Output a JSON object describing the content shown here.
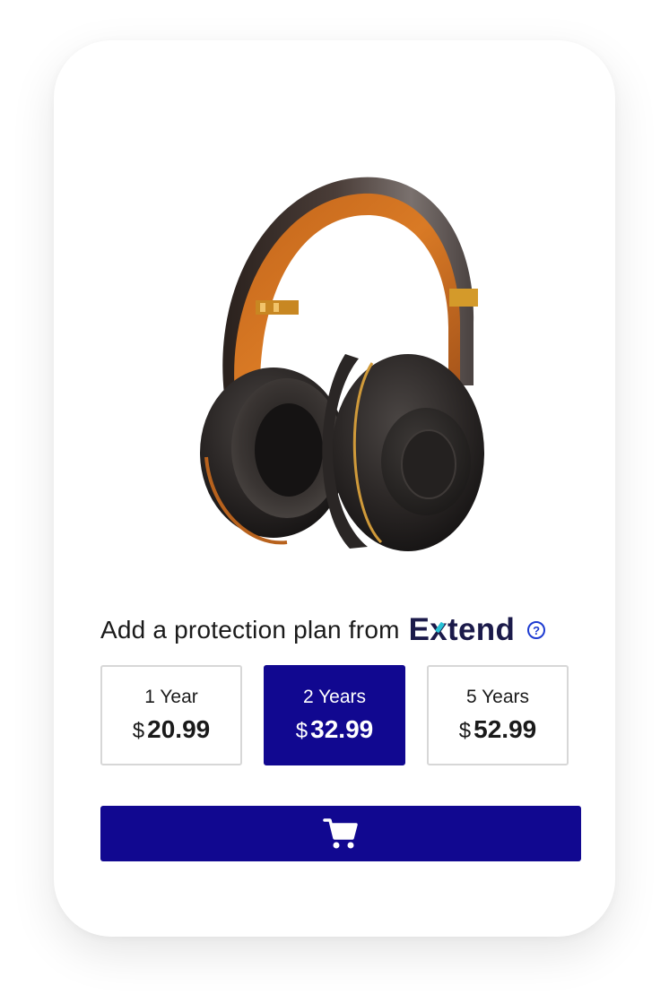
{
  "product": {
    "image_alt": "headphones"
  },
  "protection": {
    "heading": "Add a protection plan from",
    "brand_prefix": "E",
    "brand_x": "x",
    "brand_suffix": "tend",
    "help_symbol": "?",
    "plans": [
      {
        "term": "1 Year",
        "currency": "$",
        "price": "20.99",
        "selected": false
      },
      {
        "term": "2 Years",
        "currency": "$",
        "price": "32.99",
        "selected": true
      },
      {
        "term": "5 Years",
        "currency": "$",
        "price": "52.99",
        "selected": false
      }
    ]
  },
  "cart": {
    "icon": "shopping-cart-icon"
  },
  "colors": {
    "primary": "#110890",
    "brand_text": "#1b1a4a",
    "brand_accent": "#27c2d6",
    "help_icon": "#1d3bd1",
    "border": "#d7d7d7"
  }
}
